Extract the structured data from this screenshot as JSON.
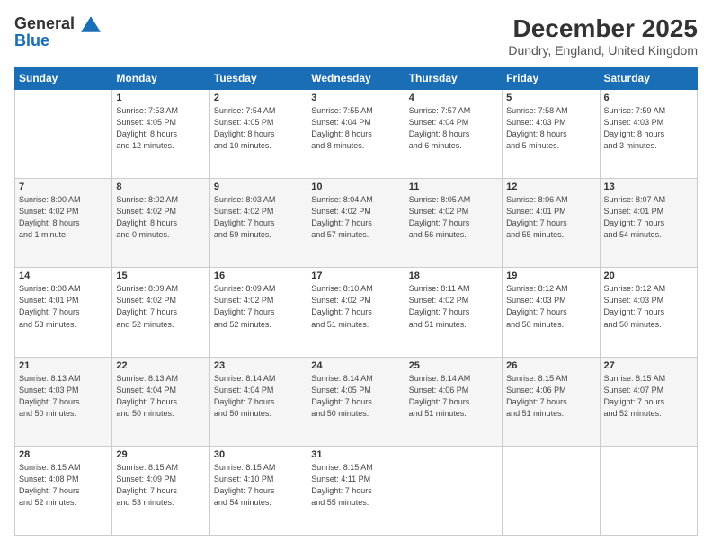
{
  "logo": {
    "line1": "General",
    "line2": "Blue"
  },
  "title": "December 2025",
  "location": "Dundry, England, United Kingdom",
  "days_header": [
    "Sunday",
    "Monday",
    "Tuesday",
    "Wednesday",
    "Thursday",
    "Friday",
    "Saturday"
  ],
  "weeks": [
    [
      {
        "day": "",
        "info": ""
      },
      {
        "day": "1",
        "info": "Sunrise: 7:53 AM\nSunset: 4:05 PM\nDaylight: 8 hours\nand 12 minutes."
      },
      {
        "day": "2",
        "info": "Sunrise: 7:54 AM\nSunset: 4:05 PM\nDaylight: 8 hours\nand 10 minutes."
      },
      {
        "day": "3",
        "info": "Sunrise: 7:55 AM\nSunset: 4:04 PM\nDaylight: 8 hours\nand 8 minutes."
      },
      {
        "day": "4",
        "info": "Sunrise: 7:57 AM\nSunset: 4:04 PM\nDaylight: 8 hours\nand 6 minutes."
      },
      {
        "day": "5",
        "info": "Sunrise: 7:58 AM\nSunset: 4:03 PM\nDaylight: 8 hours\nand 5 minutes."
      },
      {
        "day": "6",
        "info": "Sunrise: 7:59 AM\nSunset: 4:03 PM\nDaylight: 8 hours\nand 3 minutes."
      }
    ],
    [
      {
        "day": "7",
        "info": "Sunrise: 8:00 AM\nSunset: 4:02 PM\nDaylight: 8 hours\nand 1 minute."
      },
      {
        "day": "8",
        "info": "Sunrise: 8:02 AM\nSunset: 4:02 PM\nDaylight: 8 hours\nand 0 minutes."
      },
      {
        "day": "9",
        "info": "Sunrise: 8:03 AM\nSunset: 4:02 PM\nDaylight: 7 hours\nand 59 minutes."
      },
      {
        "day": "10",
        "info": "Sunrise: 8:04 AM\nSunset: 4:02 PM\nDaylight: 7 hours\nand 57 minutes."
      },
      {
        "day": "11",
        "info": "Sunrise: 8:05 AM\nSunset: 4:02 PM\nDaylight: 7 hours\nand 56 minutes."
      },
      {
        "day": "12",
        "info": "Sunrise: 8:06 AM\nSunset: 4:01 PM\nDaylight: 7 hours\nand 55 minutes."
      },
      {
        "day": "13",
        "info": "Sunrise: 8:07 AM\nSunset: 4:01 PM\nDaylight: 7 hours\nand 54 minutes."
      }
    ],
    [
      {
        "day": "14",
        "info": "Sunrise: 8:08 AM\nSunset: 4:01 PM\nDaylight: 7 hours\nand 53 minutes."
      },
      {
        "day": "15",
        "info": "Sunrise: 8:09 AM\nSunset: 4:02 PM\nDaylight: 7 hours\nand 52 minutes."
      },
      {
        "day": "16",
        "info": "Sunrise: 8:09 AM\nSunset: 4:02 PM\nDaylight: 7 hours\nand 52 minutes."
      },
      {
        "day": "17",
        "info": "Sunrise: 8:10 AM\nSunset: 4:02 PM\nDaylight: 7 hours\nand 51 minutes."
      },
      {
        "day": "18",
        "info": "Sunrise: 8:11 AM\nSunset: 4:02 PM\nDaylight: 7 hours\nand 51 minutes."
      },
      {
        "day": "19",
        "info": "Sunrise: 8:12 AM\nSunset: 4:03 PM\nDaylight: 7 hours\nand 50 minutes."
      },
      {
        "day": "20",
        "info": "Sunrise: 8:12 AM\nSunset: 4:03 PM\nDaylight: 7 hours\nand 50 minutes."
      }
    ],
    [
      {
        "day": "21",
        "info": "Sunrise: 8:13 AM\nSunset: 4:03 PM\nDaylight: 7 hours\nand 50 minutes."
      },
      {
        "day": "22",
        "info": "Sunrise: 8:13 AM\nSunset: 4:04 PM\nDaylight: 7 hours\nand 50 minutes."
      },
      {
        "day": "23",
        "info": "Sunrise: 8:14 AM\nSunset: 4:04 PM\nDaylight: 7 hours\nand 50 minutes."
      },
      {
        "day": "24",
        "info": "Sunrise: 8:14 AM\nSunset: 4:05 PM\nDaylight: 7 hours\nand 50 minutes."
      },
      {
        "day": "25",
        "info": "Sunrise: 8:14 AM\nSunset: 4:06 PM\nDaylight: 7 hours\nand 51 minutes."
      },
      {
        "day": "26",
        "info": "Sunrise: 8:15 AM\nSunset: 4:06 PM\nDaylight: 7 hours\nand 51 minutes."
      },
      {
        "day": "27",
        "info": "Sunrise: 8:15 AM\nSunset: 4:07 PM\nDaylight: 7 hours\nand 52 minutes."
      }
    ],
    [
      {
        "day": "28",
        "info": "Sunrise: 8:15 AM\nSunset: 4:08 PM\nDaylight: 7 hours\nand 52 minutes."
      },
      {
        "day": "29",
        "info": "Sunrise: 8:15 AM\nSunset: 4:09 PM\nDaylight: 7 hours\nand 53 minutes."
      },
      {
        "day": "30",
        "info": "Sunrise: 8:15 AM\nSunset: 4:10 PM\nDaylight: 7 hours\nand 54 minutes."
      },
      {
        "day": "31",
        "info": "Sunrise: 8:15 AM\nSunset: 4:11 PM\nDaylight: 7 hours\nand 55 minutes."
      },
      {
        "day": "",
        "info": ""
      },
      {
        "day": "",
        "info": ""
      },
      {
        "day": "",
        "info": ""
      }
    ]
  ]
}
